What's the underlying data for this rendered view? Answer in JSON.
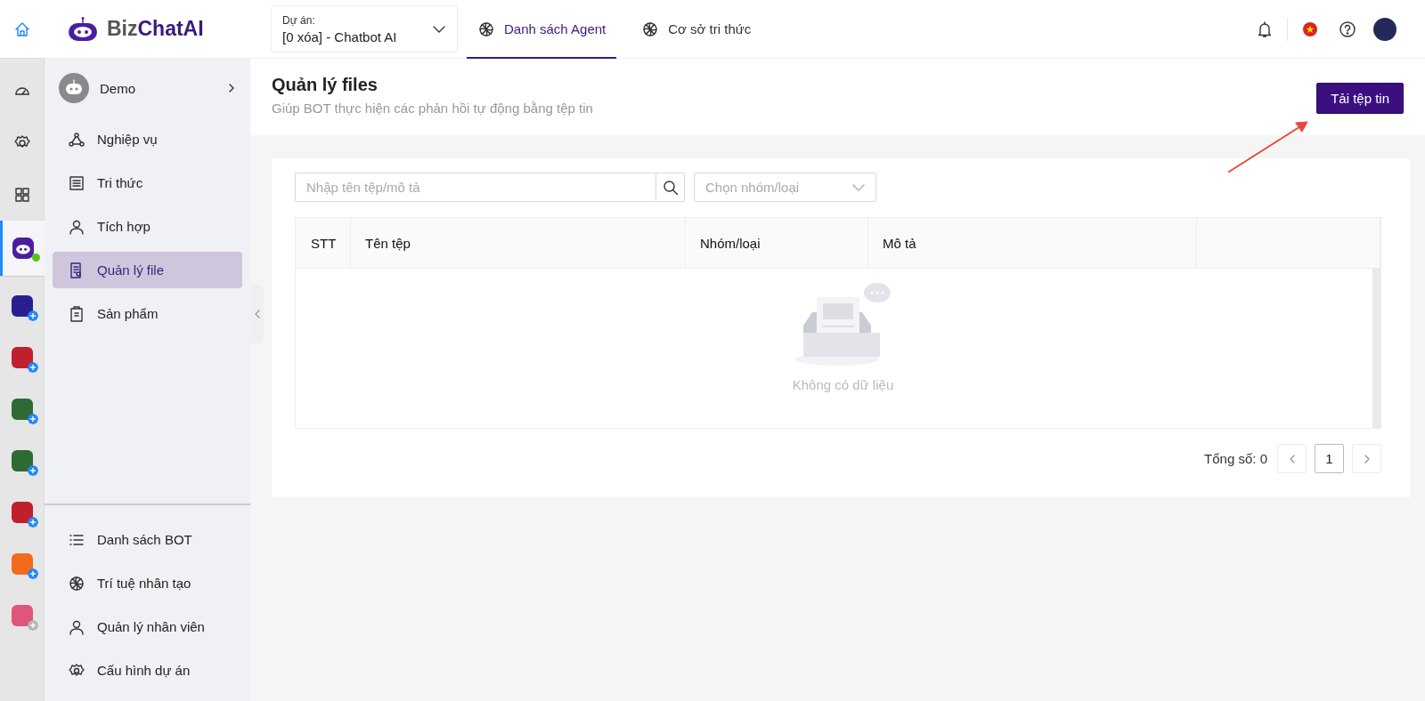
{
  "rail": {
    "items": [
      {
        "kind": "dashboard",
        "selected": false
      },
      {
        "kind": "settings",
        "selected": false
      },
      {
        "kind": "grid",
        "selected": false
      },
      {
        "kind": "bot",
        "selected": true,
        "online": true
      }
    ],
    "apps": [
      {
        "color": "#2a1f8f",
        "enabled": true
      },
      {
        "color": "#c0202e",
        "enabled": true
      },
      {
        "color": "#2e6b34",
        "enabled": true
      },
      {
        "color": "#2e6b34",
        "enabled": true
      },
      {
        "color": "#c0202e",
        "enabled": true
      },
      {
        "color": "#f26b1d",
        "enabled": true
      },
      {
        "color": "#e0557a",
        "enabled": false
      }
    ]
  },
  "header": {
    "logo": [
      "Biz",
      "ChatAI"
    ],
    "project": {
      "label": "Dự án:",
      "value": "[0 xóa] - Chatbot AI"
    },
    "tabs": [
      {
        "label": "Danh sách Agent",
        "selected": true
      },
      {
        "label": "Cơ sở tri thức",
        "selected": false
      }
    ]
  },
  "sidebar": {
    "bot": {
      "name": "Demo"
    },
    "items": [
      {
        "label": "Nghiệp vụ",
        "kind": "network",
        "selected": false
      },
      {
        "label": "Tri thức",
        "kind": "list",
        "selected": false
      },
      {
        "label": "Tích hợp",
        "kind": "user",
        "selected": false
      },
      {
        "label": "Quản lý file",
        "kind": "file",
        "selected": true
      },
      {
        "label": "Sản phẩm",
        "kind": "clipboard",
        "selected": false
      }
    ],
    "bottom_items": [
      {
        "label": "Danh sách BOT",
        "kind": "bullets"
      },
      {
        "label": "Trí tuệ nhân tạo",
        "kind": "ai"
      },
      {
        "label": "Quản lý nhân viên",
        "kind": "user"
      },
      {
        "label": "Cấu hình dự án",
        "kind": "gear"
      }
    ]
  },
  "page": {
    "title": "Quản lý files",
    "subtitle": "Giúp BOT thực hiện các phản hồi tự động bằng tệp tin",
    "upload_button": "Tải tệp tin"
  },
  "filters": {
    "search": {
      "placeholder": "Nhập tên tệp/mô tả"
    },
    "group": {
      "placeholder": "Chọn nhóm/loại"
    }
  },
  "table": {
    "columns": [
      "STT",
      "Tên tệp",
      "Nhóm/loại",
      "Mô tả"
    ],
    "empty_text": "Không có dữ liệu"
  },
  "pagination": {
    "total": "Tổng số: 0",
    "prev_disabled": true,
    "next_disabled": true,
    "pages": [
      {
        "label": "1",
        "selected": true
      }
    ]
  }
}
